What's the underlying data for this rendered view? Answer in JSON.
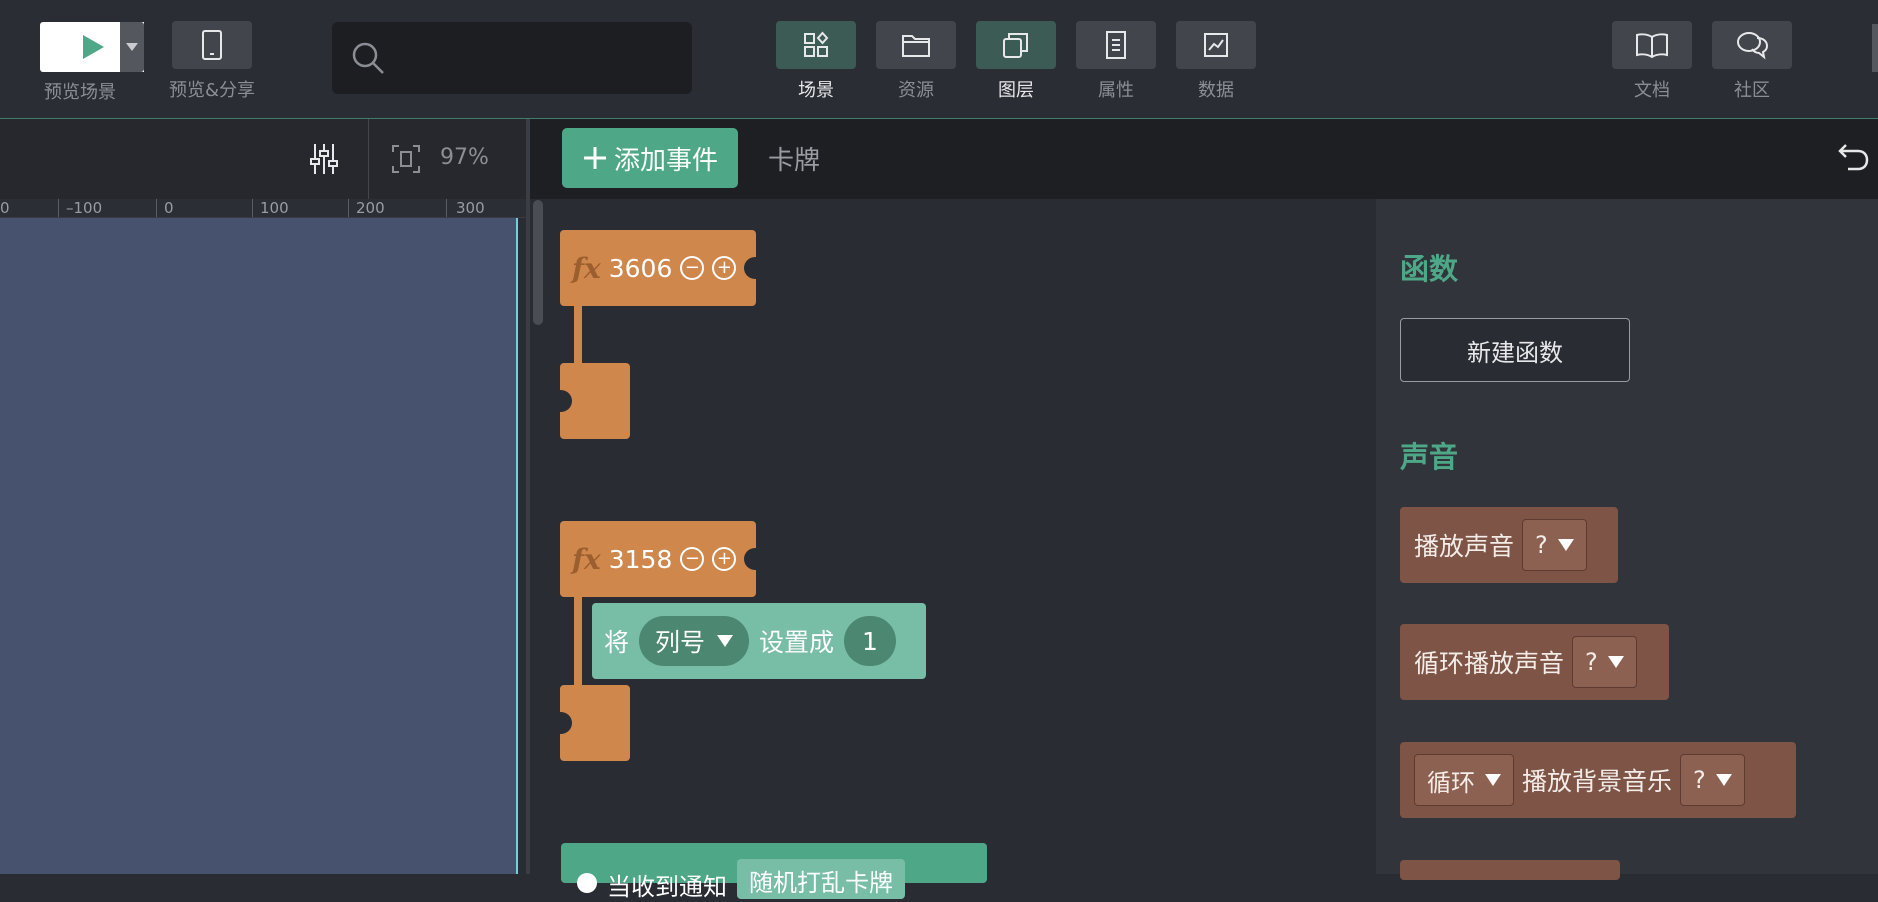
{
  "toolbar": {
    "preview_scene_label": "预览场景",
    "preview_share_label": "预览&分享",
    "search_placeholder": "",
    "tabs": [
      {
        "label": "场景",
        "icon": "grid-icon",
        "active": true
      },
      {
        "label": "资源",
        "icon": "folder-icon",
        "active": false
      },
      {
        "label": "图层",
        "icon": "layers-icon",
        "active": true
      },
      {
        "label": "属性",
        "icon": "document-icon",
        "active": false
      },
      {
        "label": "数据",
        "icon": "chart-icon",
        "active": false
      }
    ],
    "right_tabs": [
      {
        "label": "文档",
        "icon": "book-icon"
      },
      {
        "label": "社区",
        "icon": "chat-icon"
      }
    ]
  },
  "stage": {
    "zoom": "97%",
    "ruler_ticks": [
      "0",
      "–100",
      "0",
      "100",
      "200",
      "300"
    ]
  },
  "events": {
    "add_event_label": "添加事件",
    "card_tab_label": "卡牌"
  },
  "blocks": {
    "fx1_id": "3606",
    "fx2_id": "3158",
    "set_prefix": "将",
    "set_var": "列号",
    "set_mid": "设置成",
    "set_value": "1",
    "bottom_text": "当收到通知",
    "bottom_drop": "随机打乱卡牌"
  },
  "palette": {
    "functions_heading": "函数",
    "new_function_label": "新建函数",
    "sound_heading": "声音",
    "play_sound": "播放声音",
    "loop_play_sound": "循环播放声音",
    "loop_label": "循环",
    "play_bgm": "播放背景音乐",
    "unknown_value": "?"
  },
  "colors": {
    "accent": "#4ea887",
    "function_block": "#d0874c",
    "sound_block": "#7d5446",
    "variable_block": "#78bea6",
    "stage_bg": "#47526e"
  }
}
